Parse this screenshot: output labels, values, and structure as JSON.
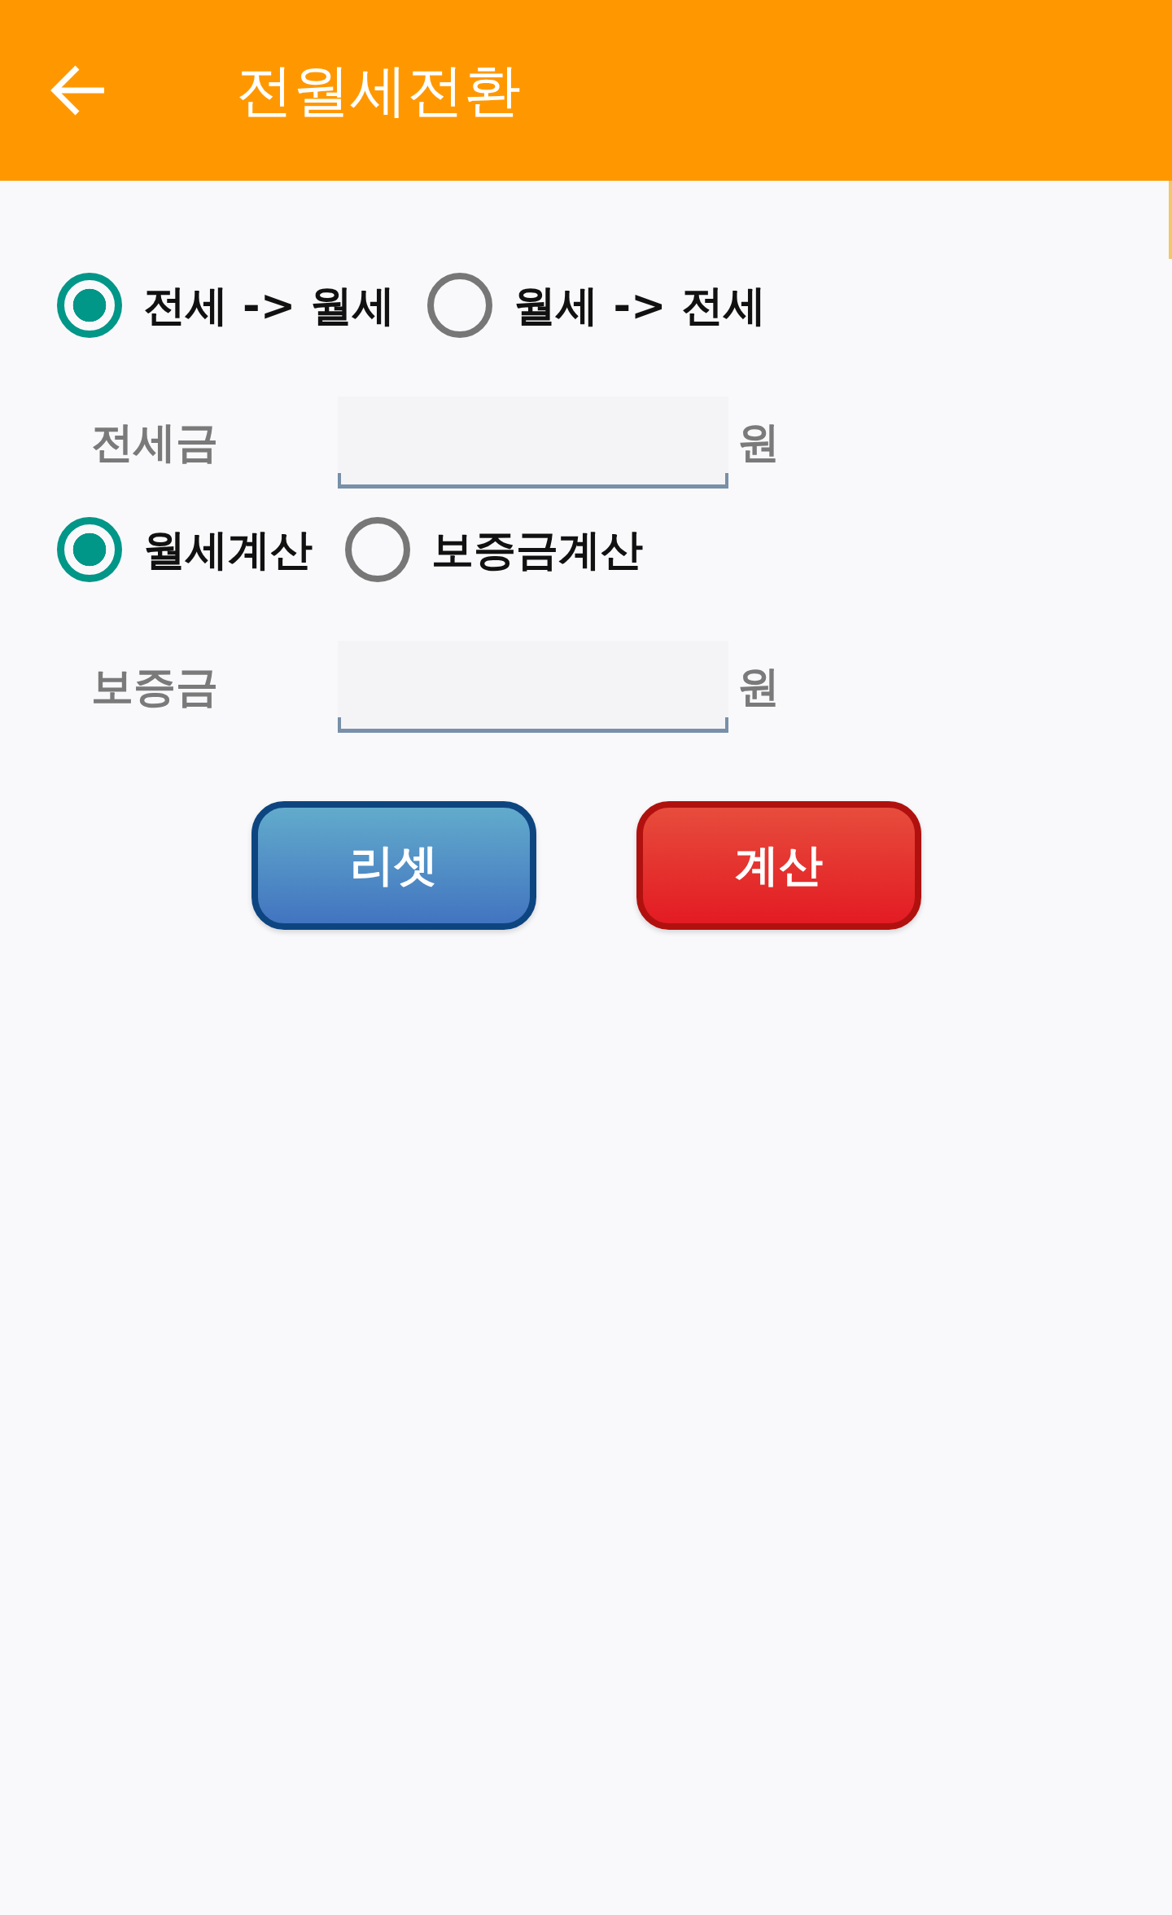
{
  "app_bar": {
    "title": "전월세전환"
  },
  "form": [
    {
      "kind": "radio_group",
      "options": [
        {
          "label": "전세 -> 월세",
          "selected": true
        },
        {
          "label": "월세 -> 전세",
          "selected": false
        }
      ]
    },
    {
      "kind": "amount_field",
      "label": "전세금",
      "unit": "원"
    },
    {
      "kind": "radio_group",
      "options": [
        {
          "label": "월세계산",
          "selected": true
        },
        {
          "label": "보증금계산",
          "selected": false
        }
      ]
    },
    {
      "kind": "amount_field",
      "label": "보증금",
      "unit": "원"
    }
  ],
  "buttons": [
    {
      "kind": "reset",
      "label": "리셋"
    },
    {
      "kind": "calculate",
      "label": "계산"
    }
  ]
}
